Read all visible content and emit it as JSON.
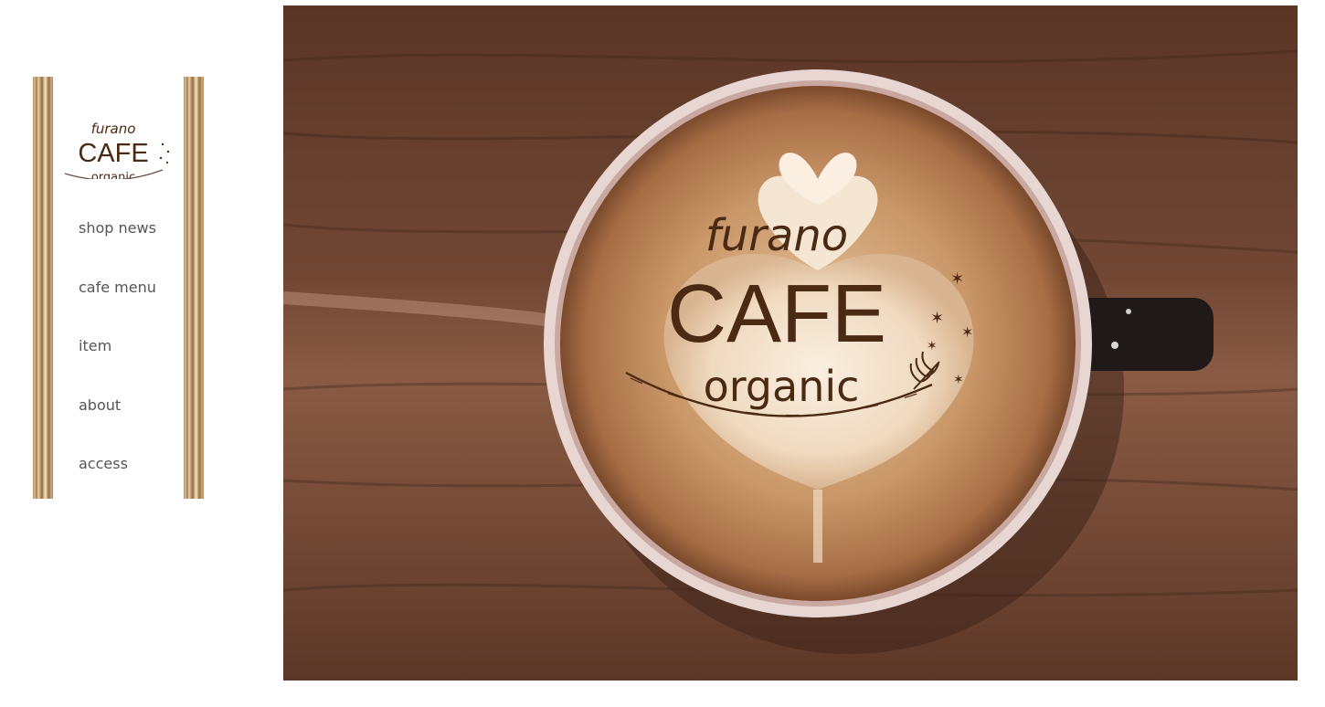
{
  "brand": {
    "line1": "furano",
    "line2": "CAFE",
    "line3": "organic"
  },
  "nav": {
    "items": [
      {
        "label": "shop news"
      },
      {
        "label": "cafe menu"
      },
      {
        "label": "item"
      },
      {
        "label": "about"
      },
      {
        "label": "access"
      }
    ]
  },
  "hero": {
    "image": "latte-art-coffee-cup-on-wooden-table"
  },
  "colors": {
    "logo_brown": "#4a2a12",
    "nav_text": "#555555",
    "table_wood": "#6b4331"
  }
}
